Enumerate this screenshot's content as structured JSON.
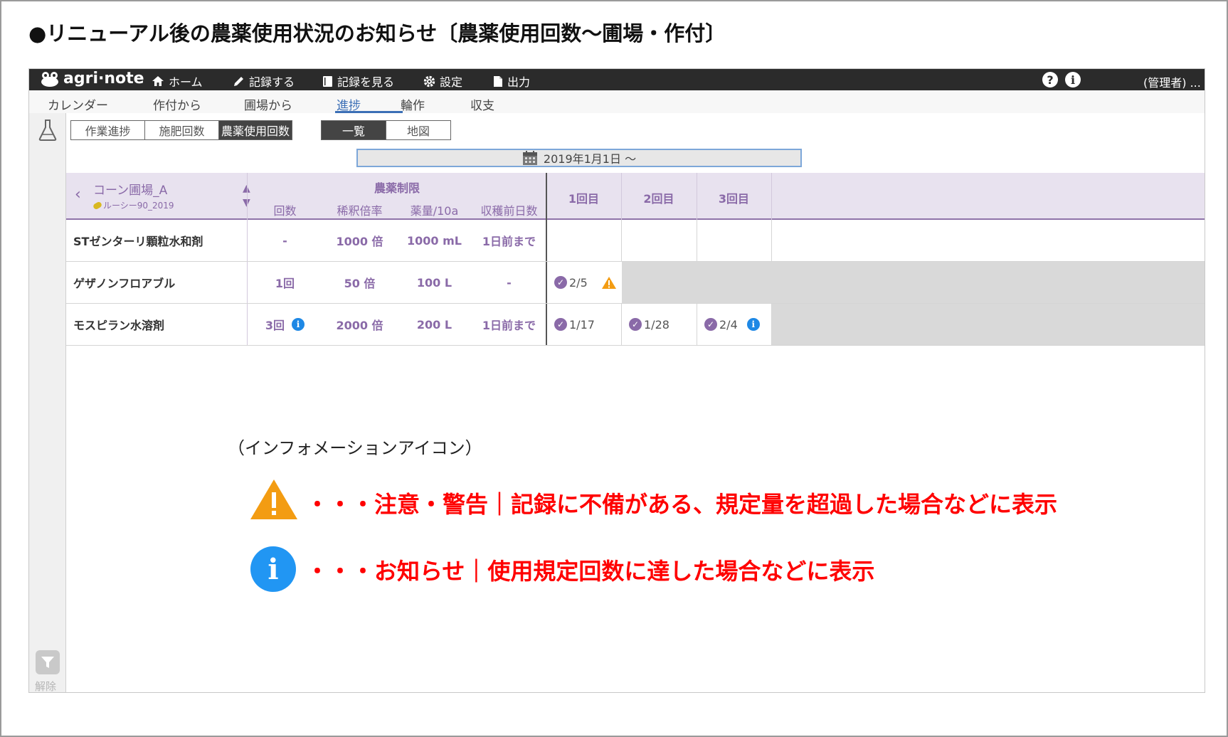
{
  "slide_title": "●リニューアル後の農薬使用状況のお知らせ〔農薬使用回数～圃場・作付〕",
  "header": {
    "logo": "agri·note",
    "nav": [
      "ホーム",
      "記録する",
      "記録を見る",
      "設定",
      "出力"
    ],
    "user": "(管理者) ..."
  },
  "subnav": [
    "カレンダー",
    "作付から",
    "圃場から",
    "進捗",
    "輪作",
    "収支"
  ],
  "segment_left": [
    "作業進捗",
    "施肥回数",
    "農薬使用回数"
  ],
  "segment_right": [
    "一覧",
    "地図"
  ],
  "date_range": "2019年1月1日 ～",
  "sidebar": {
    "filter_label": "解除"
  },
  "table": {
    "field_name": "コーン圃場_A",
    "crop_name": "ルーシー90_2019",
    "limit_header": "農薬制限",
    "limit_columns": [
      "回数",
      "稀釈倍率",
      "薬量/10a",
      "収穫前日数"
    ],
    "count_columns": [
      "1回目",
      "2回目",
      "3回目"
    ],
    "rows": [
      {
        "name": "STゼンターリ顆粒水和剤",
        "limits": [
          "-",
          "1000 倍",
          "1000 mL",
          "1日前まで"
        ],
        "records": []
      },
      {
        "name": "ゲザノンフロアブル",
        "limits": [
          "1回",
          "50 倍",
          "100 L",
          "-"
        ],
        "records": [
          "2/5"
        ]
      },
      {
        "name": "モスピラン水溶剤",
        "limits": [
          "3回",
          "2000 倍",
          "200 L",
          "1日前まで"
        ],
        "records": [
          "1/17",
          "1/28",
          "2/4"
        ]
      }
    ]
  },
  "legend": {
    "caption": "（インフォメーションアイコン）",
    "warning": "・・・注意・警告｜記録に不備がある、規定量を超過した場合などに表示",
    "info": "・・・お知らせ｜使用規定回数に達した場合などに表示"
  },
  "colors": {
    "accent": "#8a6aa8",
    "link": "#3b6fb6",
    "warning": "#f39c12",
    "info": "#2196f3",
    "legend_text": "#ff0000"
  }
}
